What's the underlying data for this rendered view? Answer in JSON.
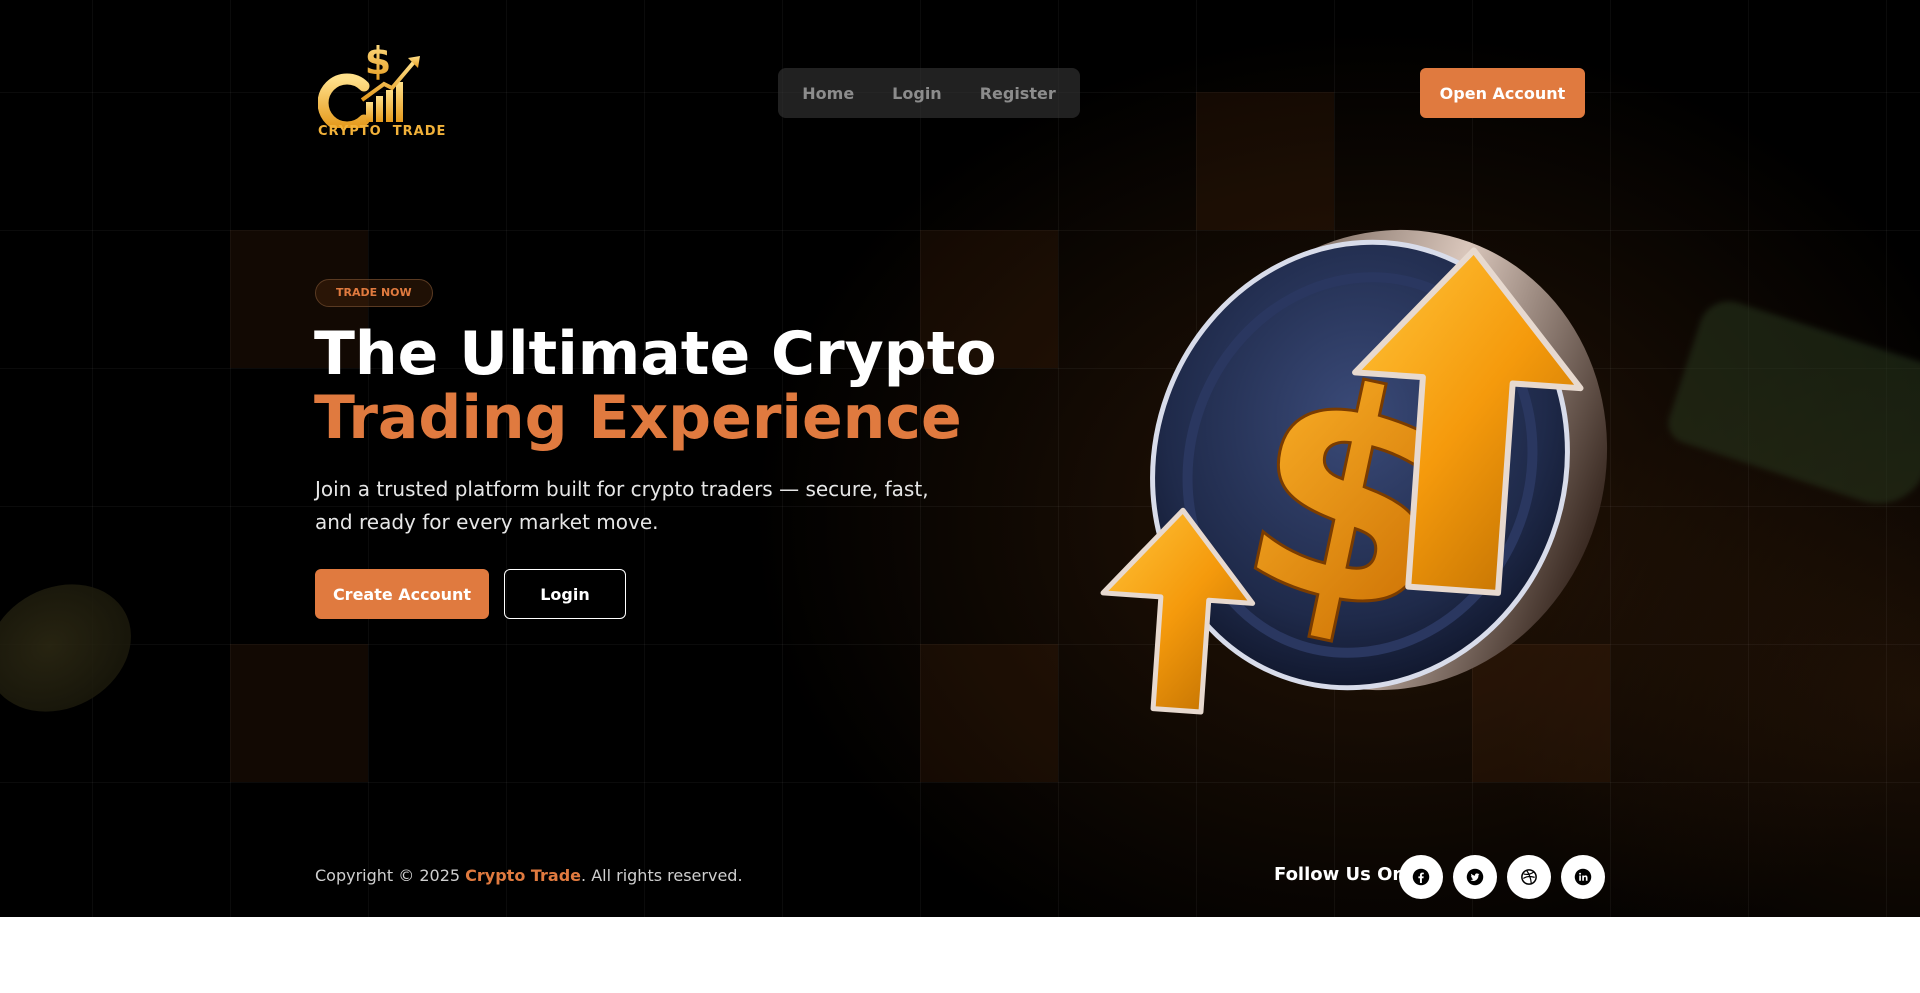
{
  "brand": {
    "logo_text": "CRYPTO  TRADE",
    "logo_icon": "dollar-chart-logo-icon"
  },
  "nav": {
    "items": [
      {
        "label": "Home"
      },
      {
        "label": "Login"
      },
      {
        "label": "Register"
      }
    ],
    "cta_label": "Open Account"
  },
  "hero": {
    "badge": "TRADE NOW",
    "title_line1": "The Ultimate Crypto",
    "title_line2": "Trading Experience",
    "subtitle": "Join a trusted platform built for crypto traders — secure, fast, and ready for every market move.",
    "primary_button": "Create Account",
    "secondary_button": "Login",
    "illustration": "coin-with-up-arrows-illustration"
  },
  "footer": {
    "copyright_prefix": "Copyright © 2025 ",
    "copyright_brand": "Crypto Trade",
    "copyright_suffix": ". All rights reserved.",
    "follow_label": "Follow Us On:",
    "socials": [
      {
        "icon": "facebook-icon"
      },
      {
        "icon": "twitter-icon"
      },
      {
        "icon": "dribbble-icon"
      },
      {
        "icon": "linkedin-icon"
      }
    ]
  },
  "colors": {
    "accent": "#e07a3f",
    "logo_gold": "#f2b23a",
    "background": "#000000",
    "coin_blue": "#1f2a4a"
  }
}
